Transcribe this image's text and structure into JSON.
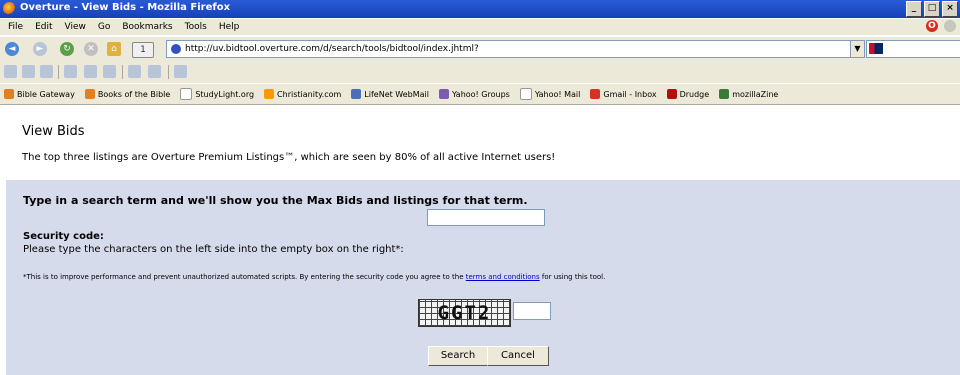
{
  "window": {
    "title": "Overture - View Bids - Mozilla Firefox",
    "min": "_",
    "max": "□",
    "close": "×"
  },
  "menu": [
    "File",
    "Edit",
    "View",
    "Go",
    "Bookmarks",
    "Tools",
    "Help"
  ],
  "nav": {
    "url": "http://uv.bidtool.overture.com/d/search/tools/bidtool/index.jhtml?"
  },
  "bookmarks": [
    {
      "label": "Bible Gateway",
      "icon": "bible-gateway-icon",
      "color": "#e08020"
    },
    {
      "label": "Books of the Bible",
      "icon": "bible-books-icon",
      "color": "#e08020"
    },
    {
      "label": "StudyLight.org",
      "icon": "page-icon",
      "color": "#ffffff"
    },
    {
      "label": "Christianity.com",
      "icon": "christianity-icon",
      "color": "#ff9900"
    },
    {
      "label": "LifeNet WebMail",
      "icon": "mail-icon",
      "color": "#4a70b8"
    },
    {
      "label": "Yahoo! Groups",
      "icon": "groups-icon",
      "color": "#7b5cb0"
    },
    {
      "label": "Yahoo! Mail",
      "icon": "page-icon",
      "color": "#ffffff"
    },
    {
      "label": "Gmail - Inbox",
      "icon": "gmail-icon",
      "color": "#d93025"
    },
    {
      "label": "Drudge",
      "icon": "drudge-icon",
      "color": "#b01010"
    },
    {
      "label": "mozillaZine",
      "icon": "mozillazine-icon",
      "color": "#3a7a3a"
    }
  ],
  "page": {
    "title": "View Bids",
    "description": "The top three listings are Overture Premium Listings™, which are seen by 80% of all active Internet users!",
    "headline": "Type in a search term and we'll show you the Max Bids and listings for that term.",
    "security_label": "Security code:",
    "security_desc": "Please type the characters on the left side into the empty box on the right*:",
    "note_before": "*This is to improve performance and prevent unauthorized automated scripts. By entering the security code you agree to the ",
    "note_link": "terms and conditions",
    "note_after": " for using this tool.",
    "captcha_text": "GGT2",
    "search_label": "Search",
    "cancel_label": "Cancel"
  }
}
